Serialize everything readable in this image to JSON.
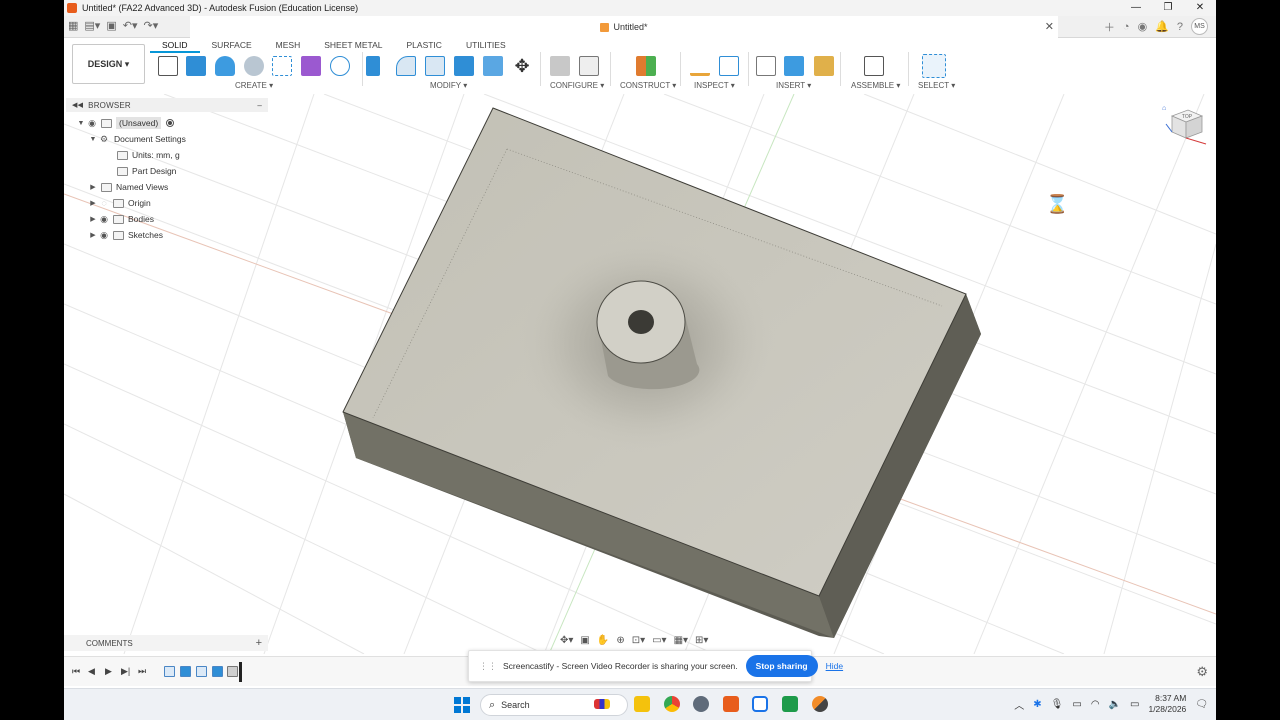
{
  "window": {
    "title": "Untitled* (FA22 Advanced 3D) - Autodesk Fusion (Education License)"
  },
  "document_tab": {
    "name": "Untitled*"
  },
  "user": {
    "initials": "MS"
  },
  "workspace": {
    "label": "DESIGN ▾"
  },
  "ribbon": {
    "tabs": [
      "SOLID",
      "SURFACE",
      "MESH",
      "SHEET METAL",
      "PLASTIC",
      "UTILITIES"
    ],
    "active_tab": "SOLID",
    "groups": {
      "create": "CREATE ▾",
      "modify": "MODIFY ▾",
      "configure": "CONFIGURE ▾",
      "construct": "CONSTRUCT ▾",
      "inspect": "INSPECT ▾",
      "insert": "INSERT ▾",
      "assemble": "ASSEMBLE ▾",
      "select": "SELECT ▾"
    }
  },
  "browser": {
    "title": "BROWSER",
    "items": [
      {
        "label": "(Unsaved)"
      },
      {
        "label": "Document Settings"
      },
      {
        "label": "Units: mm, g"
      },
      {
        "label": "Part Design"
      },
      {
        "label": "Named Views"
      },
      {
        "label": "Origin"
      },
      {
        "label": "Bodies"
      },
      {
        "label": "Sketches"
      }
    ]
  },
  "viewcube": {
    "face": "TOP"
  },
  "comments": {
    "title": "COMMENTS"
  },
  "share_banner": {
    "message": "Screencastify - Screen Video Recorder is sharing your screen.",
    "stop_label": "Stop sharing",
    "hide_label": "Hide"
  },
  "taskbar": {
    "search_placeholder": "Search",
    "time": "8:37 AM",
    "date": "1/28/2026"
  },
  "colors": {
    "accent": "#0696d7",
    "share_button": "#1a73e8",
    "model_top": "#c7c5bb",
    "model_side": "#6e6d63"
  }
}
